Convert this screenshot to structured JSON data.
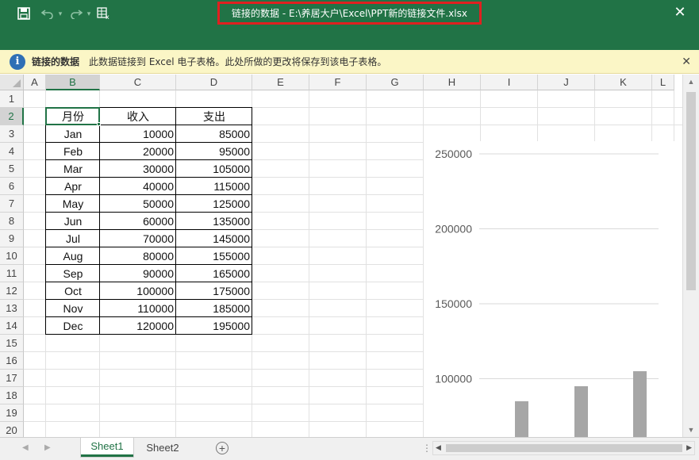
{
  "titlebar": {
    "title": "链接的数据  -  E:\\养居大户\\Excel\\PPT新的链接文件.xlsx",
    "save_icon": "save-icon",
    "undo_icon": "undo-icon",
    "redo_icon": "redo-icon",
    "sheet_icon": "spreadsheet-icon",
    "close_icon": "close-icon"
  },
  "notice": {
    "title": "链接的数据",
    "message": "此数据链接到 Excel 电子表格。此处所做的更改将保存到该电子表格。"
  },
  "columns": [
    "A",
    "B",
    "C",
    "D",
    "E",
    "F",
    "G",
    "H",
    "I",
    "J",
    "K",
    "L"
  ],
  "rows": [
    "1",
    "2",
    "3",
    "4",
    "5",
    "6",
    "7",
    "8",
    "9",
    "10",
    "11",
    "12",
    "13",
    "14",
    "15",
    "16",
    "17",
    "18",
    "19",
    "20"
  ],
  "table": {
    "headers": [
      "月份",
      "收入",
      "支出"
    ],
    "data": [
      [
        "Jan",
        "10000",
        "85000"
      ],
      [
        "Feb",
        "20000",
        "95000"
      ],
      [
        "Mar",
        "30000",
        "105000"
      ],
      [
        "Apr",
        "40000",
        "115000"
      ],
      [
        "May",
        "50000",
        "125000"
      ],
      [
        "Jun",
        "60000",
        "135000"
      ],
      [
        "Jul",
        "70000",
        "145000"
      ],
      [
        "Aug",
        "80000",
        "155000"
      ],
      [
        "Sep",
        "90000",
        "165000"
      ],
      [
        "Oct",
        "100000",
        "175000"
      ],
      [
        "Nov",
        "110000",
        "185000"
      ],
      [
        "Dec",
        "120000",
        "195000"
      ]
    ]
  },
  "chart_data": {
    "type": "bar",
    "y_ticks": [
      "250000",
      "200000",
      "150000",
      "100000"
    ],
    "ylim_visible": [
      75000,
      265000
    ],
    "visible_bars": [
      {
        "value": 85000
      },
      {
        "value": 95000
      },
      {
        "value": 105000
      }
    ],
    "bar_color": "#a6a6a6"
  },
  "sheets": {
    "tabs": [
      "Sheet1",
      "Sheet2"
    ],
    "active": "Sheet1",
    "add_label": "+"
  },
  "colors": {
    "accent": "#217346",
    "highlight": "#e02020",
    "notice_bg": "#fbf6c6"
  }
}
